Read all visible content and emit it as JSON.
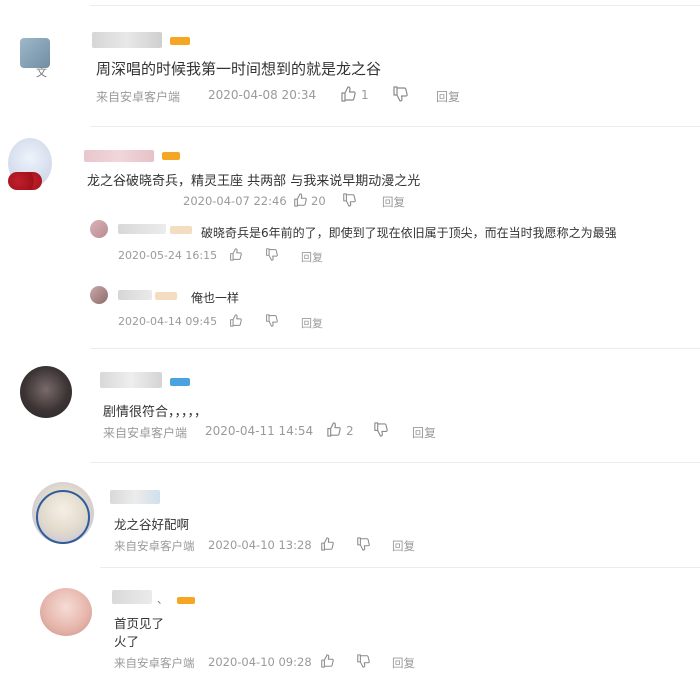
{
  "colors": {
    "text": "#333333",
    "meta": "#9a9a9a",
    "divider": "#ececec",
    "badge_orange": "#f5a623",
    "badge_blue": "#4aa3df"
  },
  "comments": [
    {
      "text": "周深唱的时候我第一时间想到的就是龙之谷",
      "source": "来自安卓客户端",
      "time": "2020-04-08 20:34",
      "likes": "1",
      "reply": "回复",
      "avatar_caption": "文"
    },
    {
      "text": "龙之谷破晓奇兵，精灵王座 共两部 与我来说早期动漫之光",
      "time": "2020-04-07 22:46",
      "likes": "20",
      "reply": "回复",
      "replies": [
        {
          "text": "破晓奇兵是6年前的了，即使到了现在依旧属于顶尖，而在当时我愿称之为最强",
          "time": "2020-05-24 16:15",
          "reply": "回复"
        },
        {
          "text": "俺也一样",
          "time": "2020-04-14 09:45",
          "reply": "回复"
        }
      ]
    },
    {
      "text": "剧情很符合，，，，，",
      "source": "来自安卓客户端",
      "time": "2020-04-11 14:54",
      "likes": "2",
      "reply": "回复"
    },
    {
      "text": "龙之谷好配啊",
      "source": "来自安卓客户端",
      "time": "2020-04-10 13:28",
      "reply": "回复"
    },
    {
      "text_line1": "首页见了",
      "text_line2": "火了",
      "source": "来自安卓客户端",
      "time": "2020-04-10 09:28",
      "reply": "回复",
      "name_suffix": "、"
    }
  ],
  "icons": {
    "like": "thumbs-up-icon",
    "dislike": "thumbs-down-icon"
  }
}
